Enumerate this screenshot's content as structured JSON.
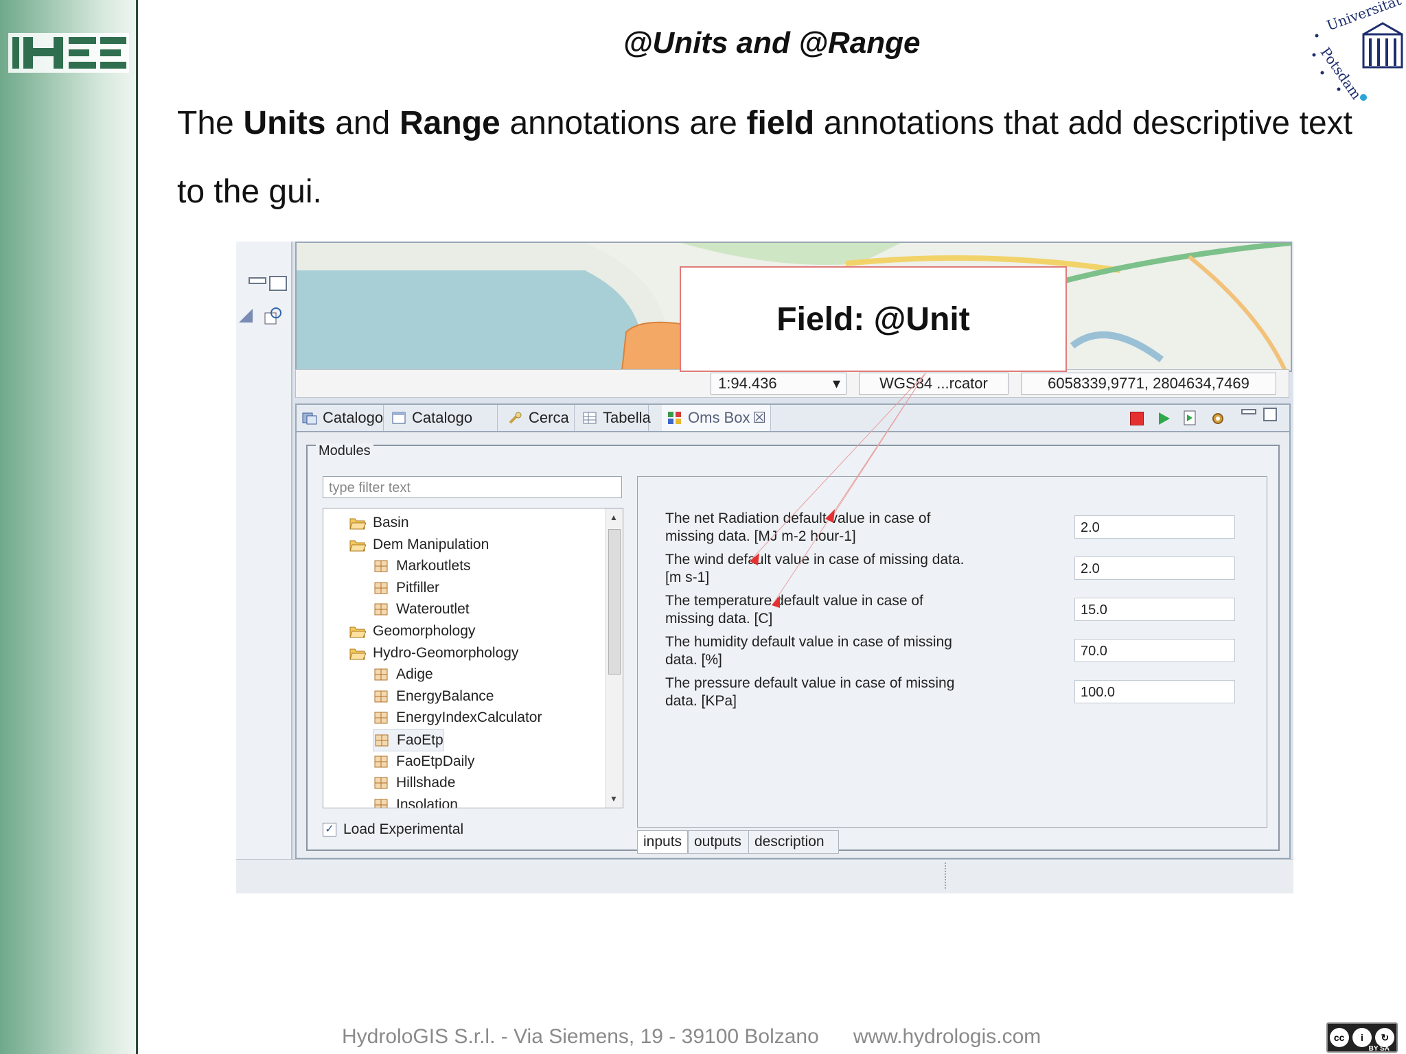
{
  "slide": {
    "title": "@Units and @Range",
    "body": {
      "t1": "The ",
      "b1": "Units",
      "t2": " and ",
      "b2": "Range",
      "t3": " annotations are ",
      "b3": "field",
      "t4": " annotations that add descriptive text to the gui."
    },
    "footer": {
      "address": "HydroloGIS S.r.l. - Via Siemens, 19 - 39100 Bolzano",
      "website": "www.hydrologis.com"
    },
    "callout": "Field: @Unit",
    "university_logo_text": [
      "Universität",
      "Potsdam"
    ],
    "license": "BY SA"
  },
  "statusbar": {
    "scale": "1:94.436",
    "crs": "WGS84 ...rcator",
    "coords": "6058339,9771, 2804634,7469"
  },
  "tabs": [
    {
      "label": "Catalogo",
      "icon": "catalog-icon"
    },
    {
      "label": "Catalogo Web",
      "icon": "web-catalog-icon"
    },
    {
      "label": "Cerca",
      "icon": "search-icon"
    },
    {
      "label": "Tabella",
      "icon": "table-icon"
    },
    {
      "label": "Oms Box",
      "icon": "omsbox-icon"
    }
  ],
  "modules": {
    "label": "Modules",
    "filter_placeholder": "type filter text",
    "tree": [
      {
        "label": "Basin",
        "level": 0,
        "kind": "folder"
      },
      {
        "label": "Dem Manipulation",
        "level": 0,
        "kind": "folder"
      },
      {
        "label": "Markoutlets",
        "level": 1,
        "kind": "module"
      },
      {
        "label": "Pitfiller",
        "level": 1,
        "kind": "module"
      },
      {
        "label": "Wateroutlet",
        "level": 1,
        "kind": "module"
      },
      {
        "label": "Geomorphology",
        "level": 0,
        "kind": "folder"
      },
      {
        "label": "Hydro-Geomorphology",
        "level": 0,
        "kind": "folder"
      },
      {
        "label": "Adige",
        "level": 1,
        "kind": "module"
      },
      {
        "label": "EnergyBalance",
        "level": 1,
        "kind": "module"
      },
      {
        "label": "EnergyIndexCalculator",
        "level": 1,
        "kind": "module"
      },
      {
        "label": "FaoEtp",
        "level": 1,
        "kind": "module",
        "selected": true
      },
      {
        "label": "FaoEtpDaily",
        "level": 1,
        "kind": "module"
      },
      {
        "label": "Hillshade",
        "level": 1,
        "kind": "module"
      },
      {
        "label": "Insolation",
        "level": 1,
        "kind": "module"
      }
    ],
    "load_experimental": "Load Experimental"
  },
  "params": [
    {
      "label": "The net Radiation default value in case of missing data. [MJ m-2 hour-1]",
      "value": "2.0"
    },
    {
      "label": "The wind default value in case of missing data. [m s-1]",
      "value": "2.0"
    },
    {
      "label": "The temperature default value in case of missing data. [C]",
      "value": "15.0"
    },
    {
      "label": "The humidity default value in case of missing data. [%]",
      "value": "70.0"
    },
    {
      "label": "The pressure default value in case of missing data. [KPa]",
      "value": "100.0"
    }
  ],
  "bottom_tabs": [
    "inputs",
    "outputs",
    "description"
  ],
  "colors": {
    "accent_red": "#e53030",
    "run_green": "#2ea84a"
  }
}
